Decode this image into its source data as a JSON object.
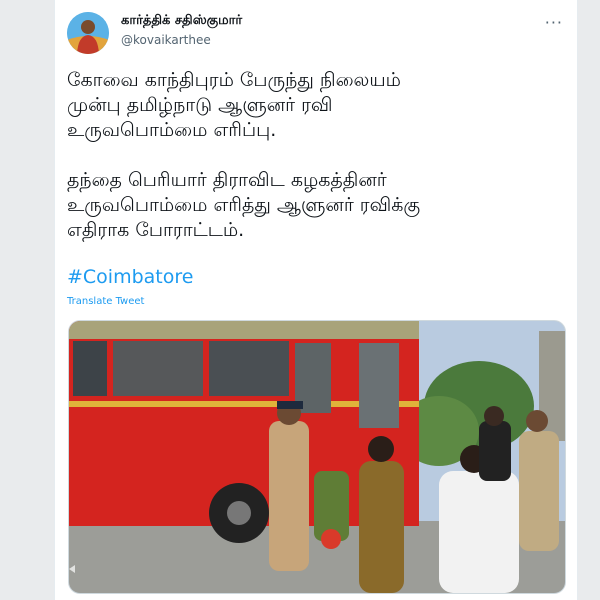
{
  "tweet": {
    "display_name": "கார்த்திக் சதிஸ்குமார்",
    "handle": "@kovaikarthee",
    "more_icon": "more-horizontal-icon",
    "text_lines_1": [
      "கோவை காந்திபுரம் பேருந்து நிலையம்",
      "முன்பு தமிழ்நாடு ஆளுனர் ரவி",
      "உருவபொம்மை எரிப்பு."
    ],
    "text_lines_2": [
      "தந்தை பெரியார் திராவிட கழகத்தினர்",
      "உருவபொம்மை எரித்து ஆளுனர் ரவிக்கு",
      "எதிராக போராட்டம்."
    ],
    "hashtag": "#Coimbatore",
    "translate_label": "Translate Tweet"
  },
  "colors": {
    "link": "#1d9bf0",
    "text": "#0f1419",
    "secondary": "#536471",
    "bus_red": "#d4241f"
  }
}
